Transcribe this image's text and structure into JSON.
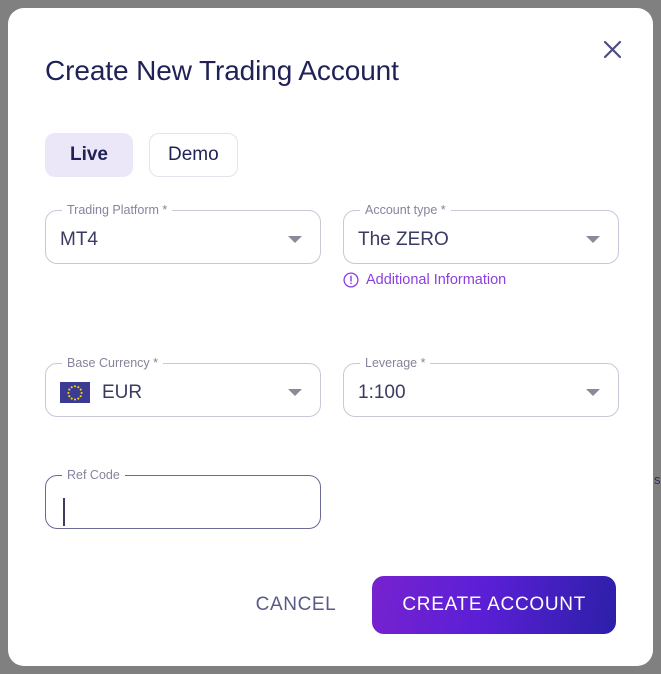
{
  "dialog": {
    "title": "Create New Trading Account",
    "close_icon": "close-icon"
  },
  "tabs": [
    {
      "label": "Live",
      "active": true
    },
    {
      "label": "Demo",
      "active": false
    }
  ],
  "fields": {
    "trading_platform": {
      "label": "Trading Platform",
      "required_marker": " *",
      "value": "MT4",
      "control": "select"
    },
    "account_type": {
      "label": "Account type",
      "required_marker": " *",
      "value": "The ZERO",
      "control": "select",
      "helper_link": "Additional Information",
      "helper_icon": "exclamation-circle-icon"
    },
    "base_currency": {
      "label": "Base Currency",
      "required_marker": " *",
      "value": "EUR",
      "control": "select",
      "flag": "eu-flag-icon"
    },
    "leverage": {
      "label": "Leverage",
      "required_marker": " *",
      "value": "1:100",
      "control": "select"
    },
    "ref_code": {
      "label": "Ref Code",
      "required_marker": "",
      "value": "",
      "placeholder": "",
      "control": "text",
      "focused": true
    }
  },
  "footer": {
    "cancel_label": "CANCEL",
    "submit_label": "CREATE ACCOUNT"
  },
  "background": {
    "edge_text": "s"
  },
  "colors": {
    "accent_purple": "#8c3fe0",
    "brand_navy": "#1f2157",
    "tab_active_bg": "#ece7f8",
    "field_border": "#c9c7d8",
    "flag_blue": "#3c3b94",
    "flag_star": "#f5d400",
    "backdrop": "#808080"
  }
}
